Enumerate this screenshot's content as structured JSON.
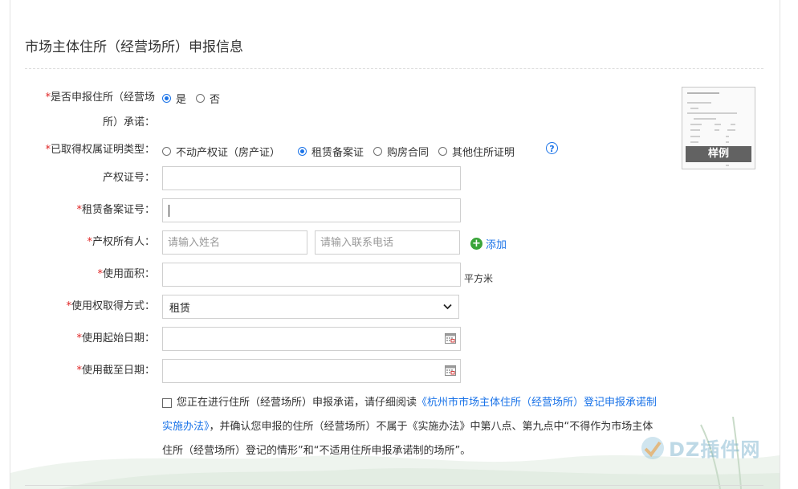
{
  "section": {
    "title": "市场主体住所（经营场所）申报信息"
  },
  "promise": {
    "required_mark": "*",
    "label_line1": "是否申报住所（经营场",
    "label_line2": "所）承诺：",
    "options": [
      {
        "label": "是",
        "selected": true
      },
      {
        "label": "否",
        "selected": false
      }
    ]
  },
  "proof_type": {
    "required_mark": "*",
    "label": "已取得权属证明类型：",
    "options": [
      {
        "label": "不动产权证（房产证）",
        "selected": false
      },
      {
        "label": "租赁备案证",
        "selected": true
      },
      {
        "label": "购房合同",
        "selected": false
      },
      {
        "label": "其他住所证明",
        "selected": false
      }
    ],
    "help_icon": "question-circle-icon"
  },
  "property_cert_no": {
    "label": "产权证号：",
    "value": ""
  },
  "lease_record_no": {
    "required_mark": "*",
    "label": "租赁备案证号：",
    "value": ""
  },
  "owner": {
    "required_mark": "*",
    "label": "产权所有人：",
    "name_placeholder": "请输入姓名",
    "phone_placeholder": "请输入联系电话",
    "add_label": "添加",
    "add_icon": "plus-circle-icon"
  },
  "area": {
    "required_mark": "*",
    "label": "使用面积：",
    "value": "",
    "unit": "平方米"
  },
  "acquire_method": {
    "required_mark": "*",
    "label": "使用权取得方式：",
    "value": "租赁"
  },
  "start_date": {
    "required_mark": "*",
    "label": "使用起始日期：",
    "value": "",
    "icon": "calendar-icon"
  },
  "end_date": {
    "required_mark": "*",
    "label": "使用截至日期：",
    "value": "",
    "icon": "calendar-icon"
  },
  "sample": {
    "label": "样例"
  },
  "declaration": {
    "checked": false,
    "text_before": "您正在进行住所（经营场所）申报承诺，请仔细阅读",
    "link_part1": "《杭州市市场主体住所（经营场所）登记申报承诺制",
    "link_part2": "实施办法》",
    "text_after_link": "，并确认您申报的住所（经营场所）不属于《实施办法》中第八点、第九点中“不得作为市场主体",
    "text_line3": "住所（经营场所）登记的情形”和“不适用住所申报承诺制的场所”。"
  },
  "watermark": {
    "text": "DZ插件网"
  },
  "colors": {
    "accent": "#1a73e8",
    "required": "#e02424",
    "add": "#3aa53a"
  }
}
